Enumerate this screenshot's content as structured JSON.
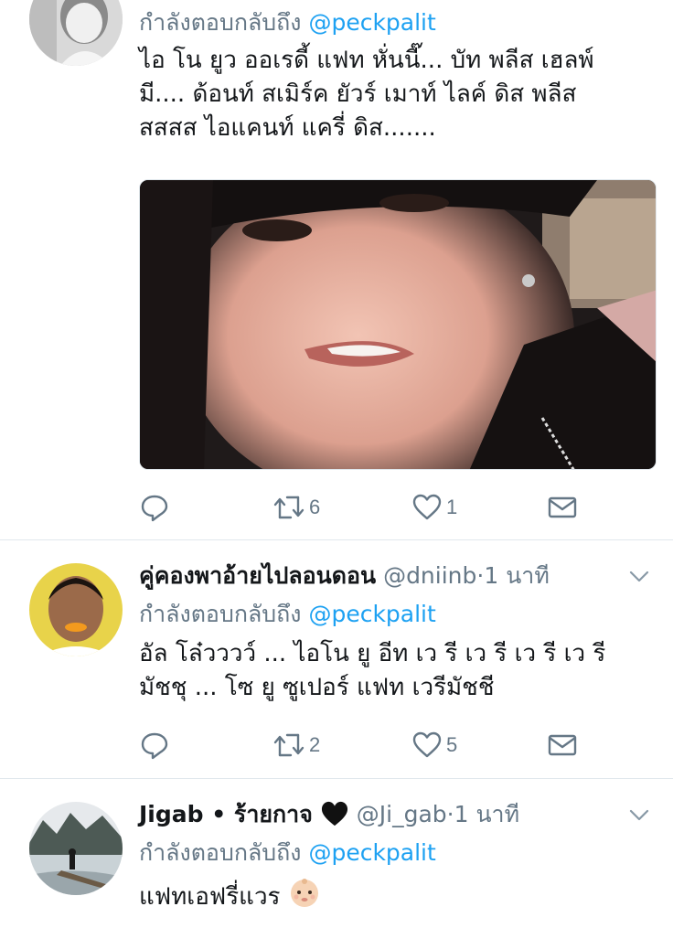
{
  "tweets": [
    {
      "reply_prefix": "กำลังตอบกลับถึง",
      "reply_mention": "@peckpalit",
      "text_lines": [
        "ไอ โน ยูว ออเรดี้ แฟท หั่นนี๊... บัท พลีส เฮลพ์",
        "มี.... ด้อนท์ สเมิร์ค ยัวร์ เมาท์ ไลค์ ดิส พลีส",
        "สสสส ไอแคนท์ แครี่ ดิส......."
      ],
      "has_media": true,
      "actions": {
        "reply": "",
        "retweet": "6",
        "like": "1"
      }
    },
    {
      "name": "คู่คองพาอ้ายไปลอนดอน",
      "handle": "@dniinb",
      "dot": "·",
      "time": "1 นาที",
      "reply_prefix": "กำลังตอบกลับถึง",
      "reply_mention": "@peckpalit",
      "text_lines": [
        "อัล โล๋วววว์ ... ไอโน ยู อีท เว รี เว รี เว รี เว รี",
        "มัชชุ ... โซ ยู ซูเปอร์ แฟท เวรีมัชชี"
      ],
      "actions": {
        "reply": "",
        "retweet": "2",
        "like": "5"
      }
    },
    {
      "name": "Jigab • ร้ายกาจ",
      "name_emoji": "🖤",
      "handle": "@Ji_gab",
      "dot": "·",
      "time": "1 นาที",
      "reply_prefix": "กำลังตอบกลับถึง",
      "reply_mention": "@peckpalit",
      "text_lines": [
        "แฟทเอฟรี่แวร"
      ],
      "text_emoji": "baby-face"
    }
  ],
  "colors": {
    "link": "#1da1f2",
    "muted": "#657786",
    "text": "#14171a",
    "divider": "#e1e8ed"
  },
  "icons": [
    "reply-icon",
    "retweet-icon",
    "like-icon",
    "dm-icon",
    "chevron-down-icon",
    "black-heart-icon",
    "baby-emoji"
  ]
}
